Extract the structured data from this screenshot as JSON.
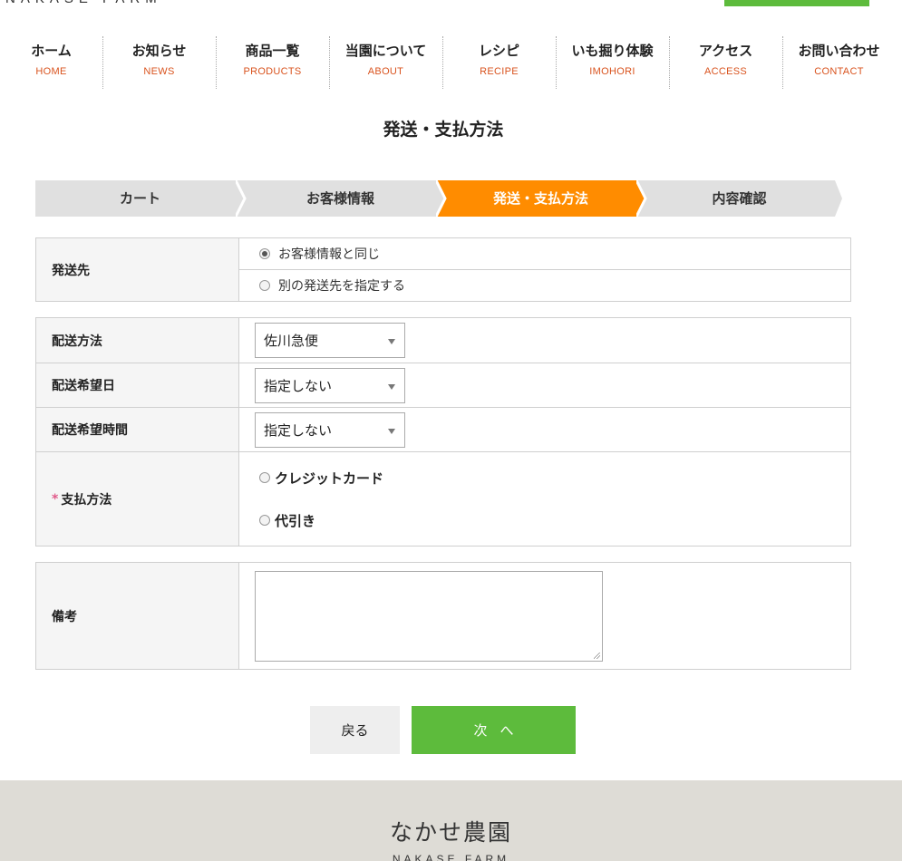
{
  "brand": {
    "logo_en": "NAKASE FARM",
    "logo_jp": "なかせ農園"
  },
  "nav": [
    {
      "jp": "ホーム",
      "en": "HOME"
    },
    {
      "jp": "お知らせ",
      "en": "NEWS"
    },
    {
      "jp": "商品一覧",
      "en": "PRODUCTS"
    },
    {
      "jp": "当園について",
      "en": "ABOUT"
    },
    {
      "jp": "レシピ",
      "en": "RECIPE"
    },
    {
      "jp": "いも掘り体験",
      "en": "IMOHORI"
    },
    {
      "jp": "アクセス",
      "en": "ACCESS"
    },
    {
      "jp": "お問い合わせ",
      "en": "CONTACT"
    }
  ],
  "page_title": "発送・支払方法",
  "steps": [
    {
      "label": "カート",
      "active": false
    },
    {
      "label": "お客様情報",
      "active": false
    },
    {
      "label": "発送・支払方法",
      "active": true
    },
    {
      "label": "内容確認",
      "active": false
    }
  ],
  "shipping_dest": {
    "label": "発送先",
    "options": [
      {
        "label": "お客様情報と同じ",
        "checked": true
      },
      {
        "label": "別の発送先を指定する",
        "checked": false
      }
    ]
  },
  "delivery": {
    "method_label": "配送方法",
    "method_value": "佐川急便",
    "date_label": "配送希望日",
    "date_value": "指定しない",
    "time_label": "配送希望時間",
    "time_value": "指定しない"
  },
  "payment": {
    "required_mark": "*",
    "label": "支払方法",
    "options": [
      {
        "label": "クレジットカード",
        "checked": false
      },
      {
        "label": "代引き",
        "checked": false
      }
    ]
  },
  "notes": {
    "label": "備考",
    "value": ""
  },
  "buttons": {
    "back": "戻る",
    "next": "次へ"
  },
  "colors": {
    "accent_green": "#5dbb3c",
    "active_step": "#ff8c00",
    "step_gray": "#e0e0e0",
    "nav_en": "#d9531e"
  }
}
